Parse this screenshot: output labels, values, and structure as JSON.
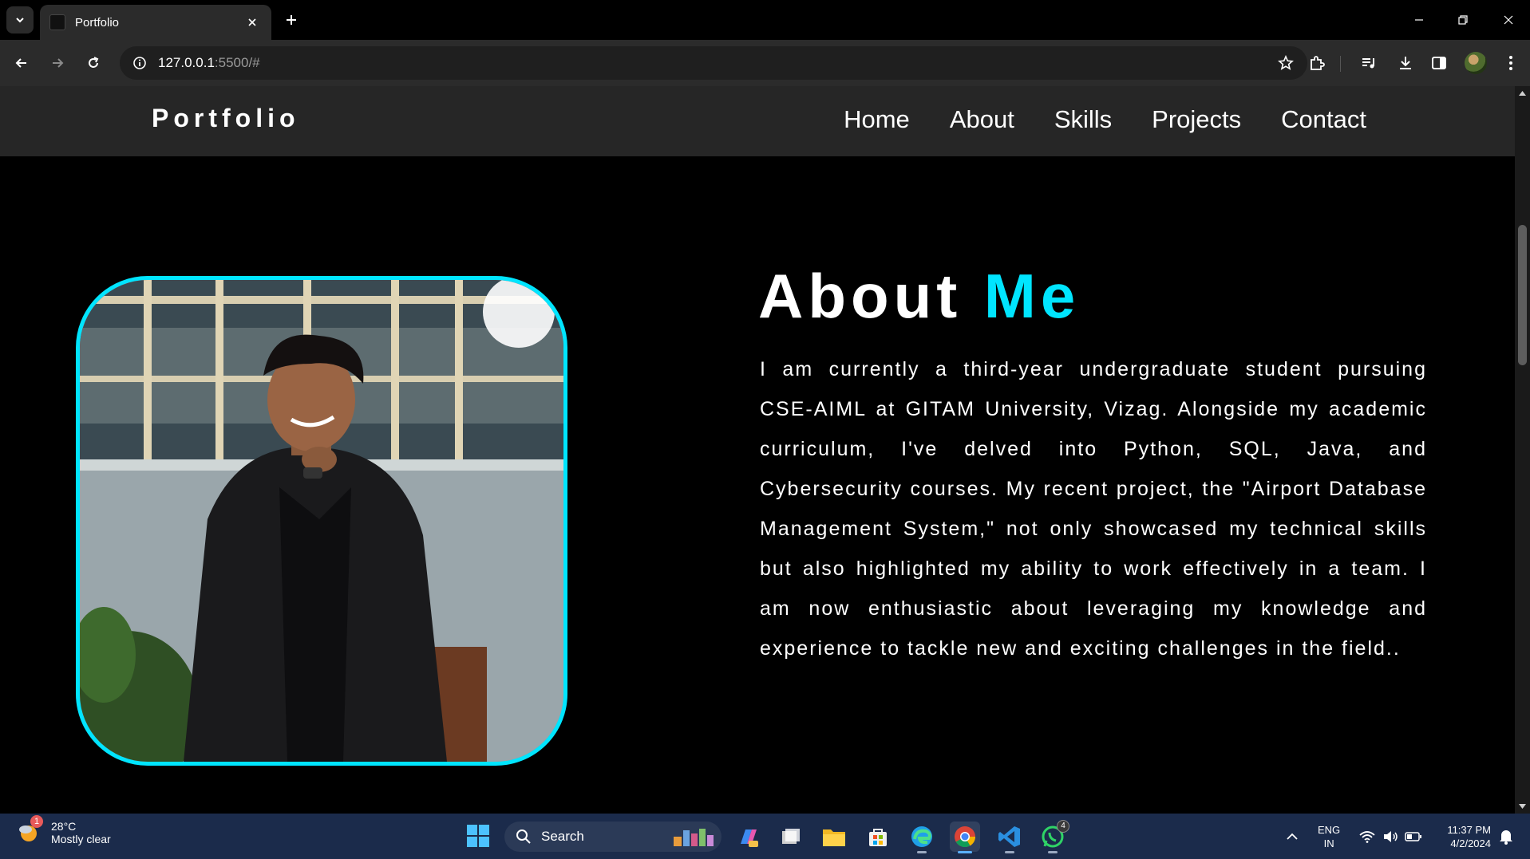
{
  "browser": {
    "tab": {
      "title": "Portfolio"
    },
    "url": {
      "host": "127.0.0.1",
      "rest": ":5500/#"
    }
  },
  "page": {
    "logo": "Portfolio",
    "nav": [
      "Home",
      "About",
      "Skills",
      "Projects",
      "Contact"
    ],
    "about": {
      "title_word": "About",
      "title_accent": "Me",
      "paragraph": "I am currently a third-year undergraduate student pursuing CSE-AIML at GITAM University, Vizag. Alongside my academic curriculum, I've delved into Python, SQL, Java, and Cybersecurity courses. My recent project, the \"Airport Database Management System,\" not only showcased my technical skills but also highlighted my ability to work effectively in a team. I am now enthusiastic about leveraging my knowledge and experience to tackle new and exciting challenges in the field.."
    },
    "accent_color": "#00e5ff"
  },
  "taskbar": {
    "weather": {
      "temp": "28°C",
      "desc": "Mostly clear",
      "badge": "1"
    },
    "search_label": "Search",
    "apps": [
      "file-explorer",
      "edge",
      "chrome",
      "vscode",
      "whatsapp"
    ],
    "whatsapp_badge": "4",
    "language": {
      "line1": "ENG",
      "line2": "IN"
    },
    "clock": {
      "time": "11:37 PM",
      "date": "4/2/2024"
    }
  }
}
